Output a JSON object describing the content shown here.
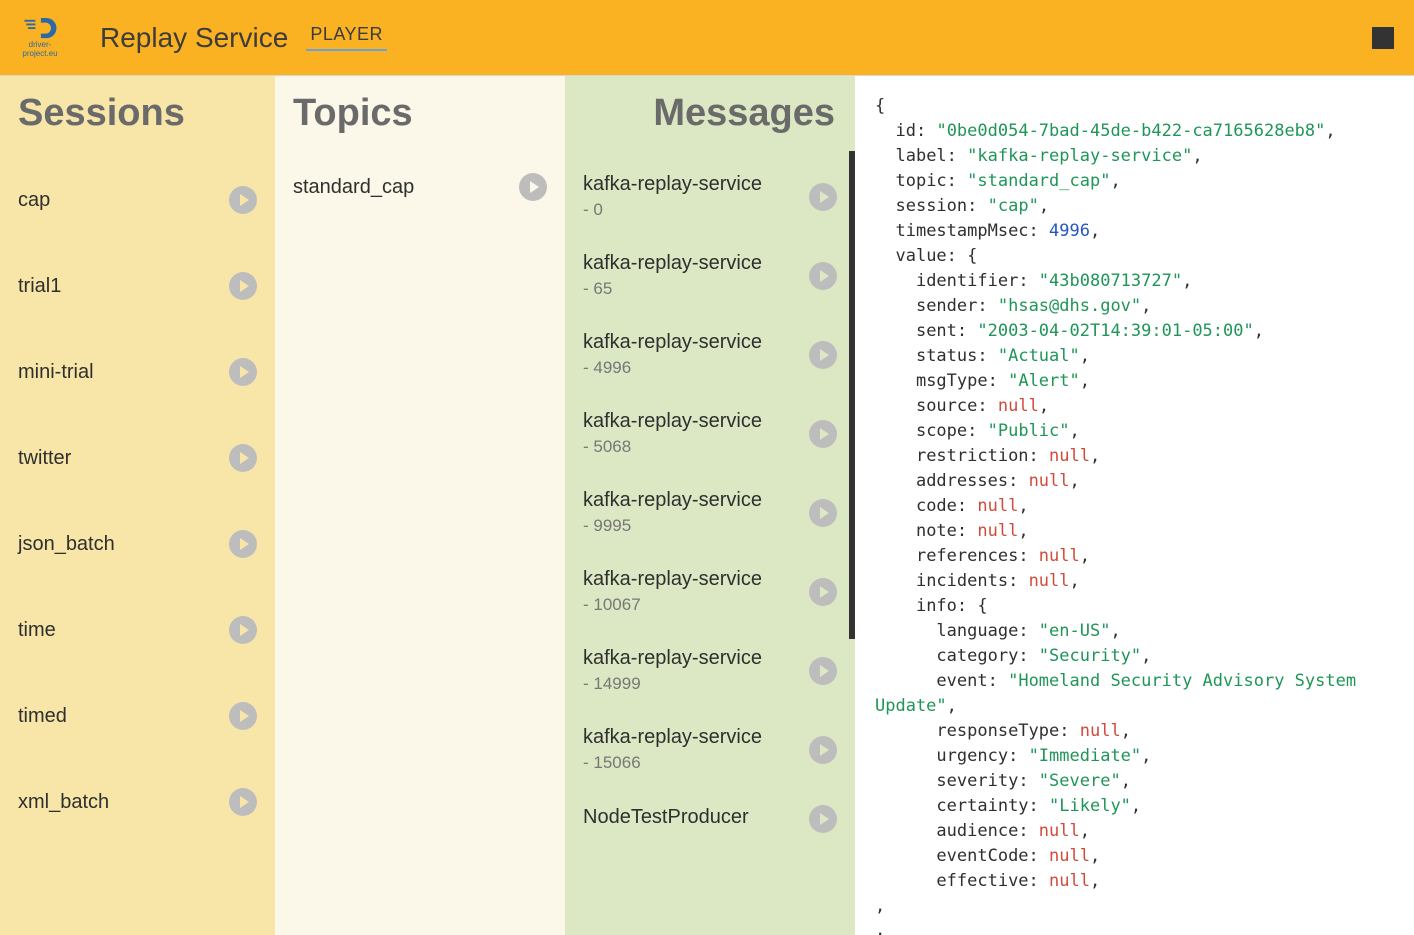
{
  "header": {
    "logo_caption": "driver-project.eu",
    "app_title": "Replay Service",
    "tab_label": "PLAYER"
  },
  "columns": {
    "sessions_title": "Sessions",
    "topics_title": "Topics",
    "messages_title": "Messages"
  },
  "sessions": [
    {
      "name": "cap"
    },
    {
      "name": "trial1"
    },
    {
      "name": "mini-trial"
    },
    {
      "name": "twitter"
    },
    {
      "name": "json_batch"
    },
    {
      "name": "time"
    },
    {
      "name": "timed"
    },
    {
      "name": "xml_batch"
    }
  ],
  "topics": [
    {
      "name": "standard_cap"
    }
  ],
  "messages": [
    {
      "label": "kafka-replay-service",
      "offset": "- 0"
    },
    {
      "label": "kafka-replay-service",
      "offset": "- 65"
    },
    {
      "label": "kafka-replay-service",
      "offset": "- 4996"
    },
    {
      "label": "kafka-replay-service",
      "offset": "- 5068"
    },
    {
      "label": "kafka-replay-service",
      "offset": "- 9995"
    },
    {
      "label": "kafka-replay-service",
      "offset": "- 10067"
    },
    {
      "label": "kafka-replay-service",
      "offset": "- 14999"
    },
    {
      "label": "kafka-replay-service",
      "offset": "- 15066"
    },
    {
      "label": "NodeTestProducer",
      "offset": ""
    }
  ],
  "detail": {
    "id": "0be0d054-7bad-45de-b422-ca7165628eb8",
    "label": "kafka-replay-service",
    "topic": "standard_cap",
    "session": "cap",
    "timestampMsec": 4996,
    "value": {
      "identifier": "43b080713727",
      "sender": "hsas@dhs.gov",
      "sent": "2003-04-02T14:39:01-05:00",
      "status": "Actual",
      "msgType": "Alert",
      "source": null,
      "scope": "Public",
      "restriction": null,
      "addresses": null,
      "code": null,
      "note": null,
      "references": null,
      "incidents": null,
      "info": {
        "language": "en-US",
        "category": "Security",
        "event": "Homeland Security Advisory System Update",
        "responseType": null,
        "urgency": "Immediate",
        "severity": "Severe",
        "certainty": "Likely",
        "audience": null,
        "eventCode": null,
        "effective": null
      }
    }
  }
}
